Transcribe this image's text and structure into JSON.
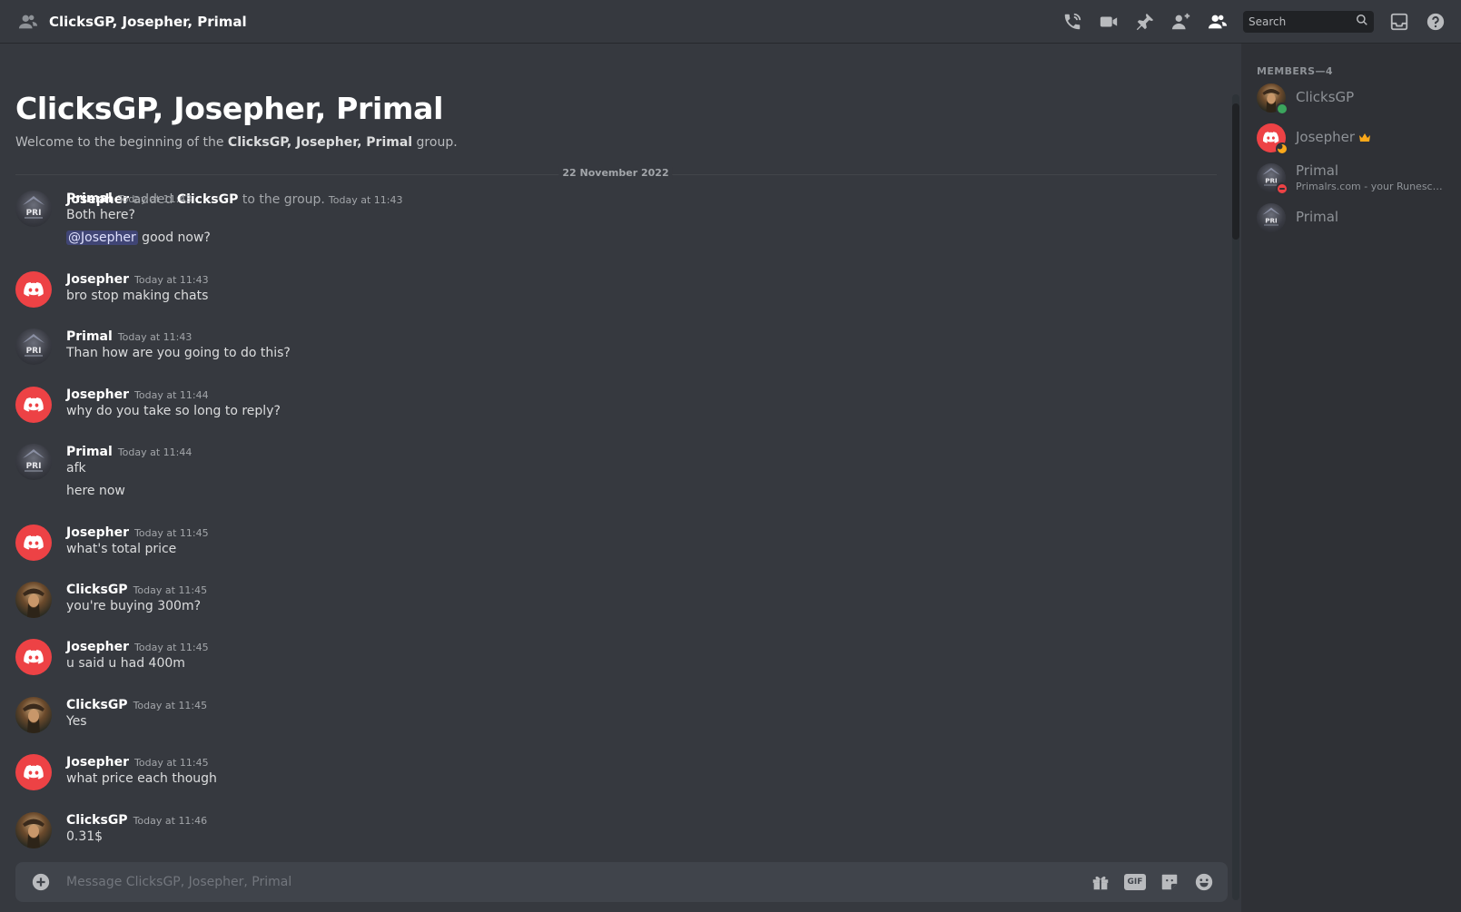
{
  "header": {
    "title": "ClicksGP, Josepher, Primal",
    "icons": [
      "group-dm-icon",
      "start-voice-call-icon",
      "start-video-call-icon",
      "pinned-messages-icon",
      "add-friends-icon",
      "member-list-icon",
      "inbox-icon",
      "help-icon"
    ],
    "search_placeholder": "Search"
  },
  "welcome": {
    "title": "ClicksGP, Josepher, Primal",
    "prefix": "Welcome to the beginning of the ",
    "group_name": "ClicksGP, Josepher, Primal",
    "suffix": " group."
  },
  "date_divider": "22 November 2022",
  "system_message": {
    "actor": "Josepher",
    "verb": " added ",
    "target": "ClicksGP",
    "suffix": " to the group.",
    "time": "Today at 11:43"
  },
  "messages": [
    {
      "author": "Primal",
      "time": "Today at 11:43",
      "lines": [
        "Both here?"
      ],
      "mention": "@Josepher",
      "mention_rest": " good now?"
    },
    {
      "author": "Josepher",
      "time": "Today at 11:43",
      "lines": [
        "bro stop making chats"
      ]
    },
    {
      "author": "Primal",
      "time": "Today at 11:43",
      "lines": [
        "Than how are you going to do this?"
      ]
    },
    {
      "author": "Josepher",
      "time": "Today at 11:44",
      "lines": [
        "why do you take so long to reply?"
      ]
    },
    {
      "author": "Primal",
      "time": "Today at 11:44",
      "lines": [
        "afk",
        "here now"
      ]
    },
    {
      "author": "Josepher",
      "time": "Today at 11:45",
      "lines": [
        "what's total price"
      ]
    },
    {
      "author": "ClicksGP",
      "time": "Today at 11:45",
      "lines": [
        "you're buying 300m?"
      ]
    },
    {
      "author": "Josepher",
      "time": "Today at 11:45",
      "lines": [
        "u said u had 400m"
      ]
    },
    {
      "author": "ClicksGP",
      "time": "Today at 11:45",
      "lines": [
        "Yes"
      ]
    },
    {
      "author": "Josepher",
      "time": "Today at 11:45",
      "lines": [
        "what price each though"
      ]
    },
    {
      "author": "ClicksGP",
      "time": "Today at 11:46",
      "lines": [
        "0.31$"
      ]
    }
  ],
  "composer": {
    "placeholder": "Message ClicksGP, Josepher, Primal",
    "icons": [
      "attach-plus-icon",
      "gift-icon",
      "gif-icon",
      "sticker-icon",
      "emoji-icon"
    ],
    "gif_label": "GIF"
  },
  "members": {
    "header": "MEMBERS—4",
    "list": [
      {
        "name": "ClicksGP",
        "status": "online",
        "subtitle": ""
      },
      {
        "name": "Josepher",
        "status": "idle",
        "subtitle": "",
        "owner": true
      },
      {
        "name": "Primal",
        "status": "dnd",
        "subtitle": "Primalrs.com - your Runescape Gold Shop"
      },
      {
        "name": "Primal",
        "status": "",
        "subtitle": ""
      }
    ]
  },
  "colors": {
    "background": "#36393f",
    "sidebar": "#2f3136",
    "discord_red": "#ed4245",
    "online": "#3ba55d",
    "idle": "#faa81a",
    "dnd": "#ed4245",
    "mention_bg": "#3f4478",
    "join_arrow": "#3ba55d"
  }
}
